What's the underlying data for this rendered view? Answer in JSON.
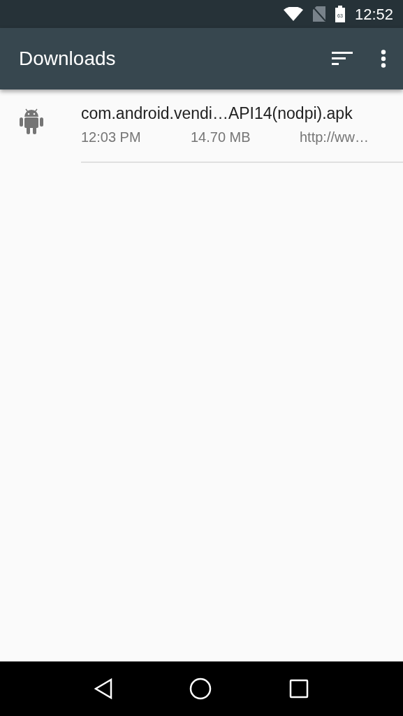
{
  "status_bar": {
    "battery_text": "63",
    "time": "12:52"
  },
  "toolbar": {
    "title": "Downloads"
  },
  "downloads": [
    {
      "name": "com.android.vendi…API14(nodpi).apk",
      "time": "12:03 PM",
      "size": "14.70 MB",
      "source": "http://ww…"
    }
  ]
}
